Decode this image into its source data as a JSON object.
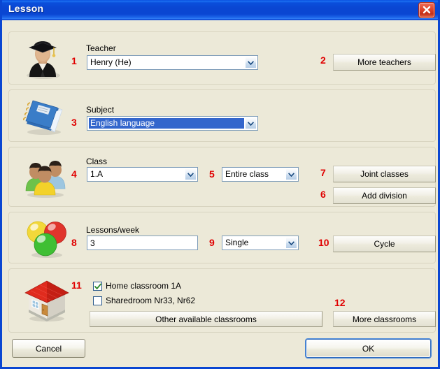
{
  "window": {
    "title": "Lesson",
    "close_icon": "close-x-icon",
    "accent_color": "#0a46d2",
    "face_color": "#ece9d8",
    "marker_color": "#e00000"
  },
  "sections": {
    "teacher": {
      "icon": "graduate-teacher-icon",
      "label": "Teacher",
      "marker_field": "1",
      "combo_value": "Henry (He)",
      "marker_button": "2",
      "button_label": "More teachers"
    },
    "subject": {
      "icon": "notebook-subject-icon",
      "label": "Subject",
      "marker_field": "3",
      "combo_value": "English language",
      "selected": true
    },
    "class": {
      "icon": "people-class-icon",
      "label": "Class",
      "marker_class": "4",
      "class_value": "1.A",
      "marker_scope": "5",
      "scope_value": "Entire class",
      "marker_joint": "7",
      "joint_label": "Joint classes",
      "marker_division": "6",
      "division_label": "Add division"
    },
    "lessons": {
      "icon": "balloons-lessons-icon",
      "label": "Lessons/week",
      "marker_count": "8",
      "count_value": "3",
      "marker_kind": "9",
      "kind_value": "Single",
      "marker_cycle": "10",
      "cycle_label": "Cycle"
    },
    "classroom": {
      "icon": "house-classroom-icon",
      "marker_checks": "11",
      "check1_label": "Home classroom 1A",
      "check1_checked": true,
      "check2_label": "Sharedroom Nr33, Nr62",
      "check2_checked": false,
      "other_label": "Other available classrooms",
      "marker_more": "12",
      "more_label": "More classrooms"
    }
  },
  "footer": {
    "cancel_label": "Cancel",
    "ok_label": "OK"
  }
}
